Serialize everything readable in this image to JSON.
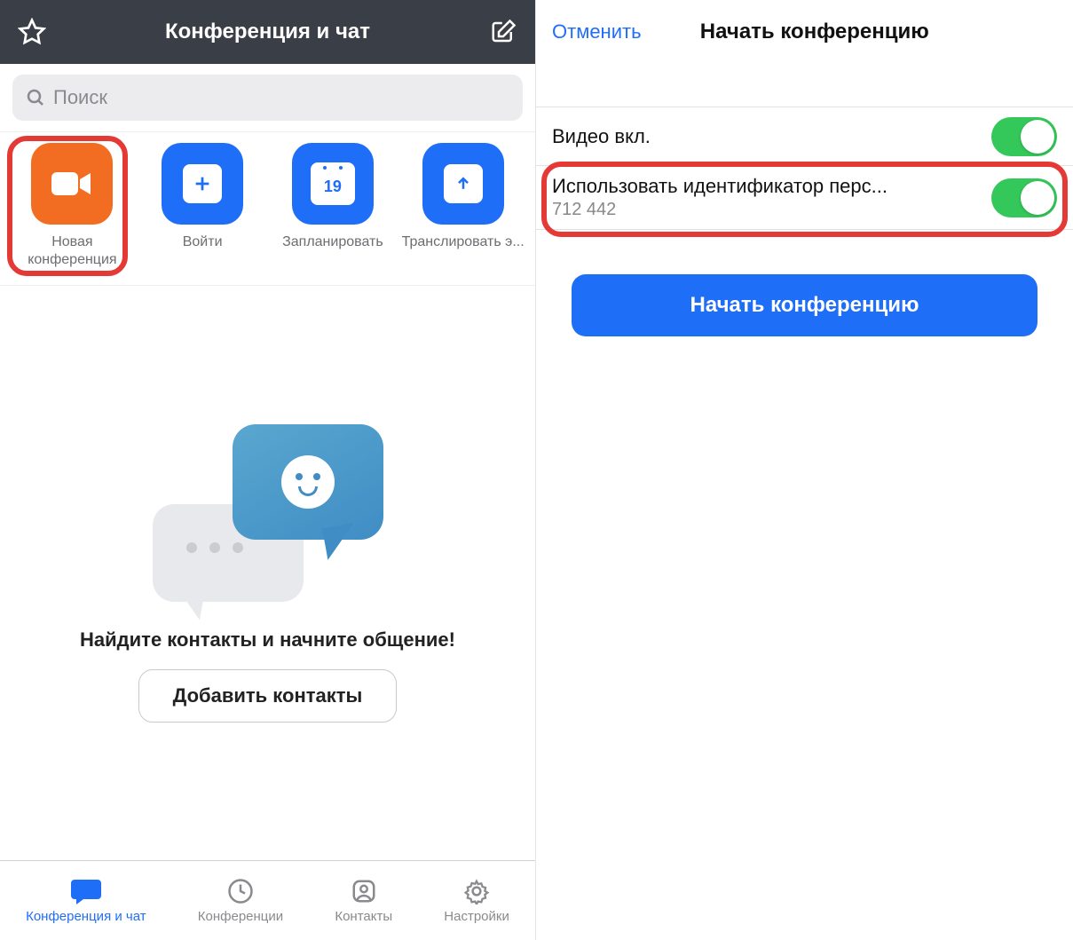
{
  "left": {
    "header_title": "Конференция и чат",
    "search_placeholder": "Поиск",
    "tiles": [
      {
        "label": "Новая конференция"
      },
      {
        "label": "Войти"
      },
      {
        "label": "Запланировать",
        "cal_day": "19"
      },
      {
        "label": "Транслировать э..."
      }
    ],
    "empty_title": "Найдите контакты и начните общение!",
    "empty_button": "Добавить контакты",
    "tabs": [
      {
        "label": "Конференция и чат",
        "active": true
      },
      {
        "label": "Конференции"
      },
      {
        "label": "Контакты"
      },
      {
        "label": "Настройки"
      }
    ]
  },
  "right": {
    "cancel": "Отменить",
    "title": "Начать конференцию",
    "row_video": "Видео вкл.",
    "row_pmi_label": "Использовать идентификатор перс...",
    "row_pmi_value": "712 442",
    "start_button": "Начать конференцию"
  },
  "colors": {
    "accent_blue": "#1f6ef7",
    "accent_orange": "#f26d21",
    "toggle_green": "#34c759",
    "highlight_red": "#e53935"
  }
}
